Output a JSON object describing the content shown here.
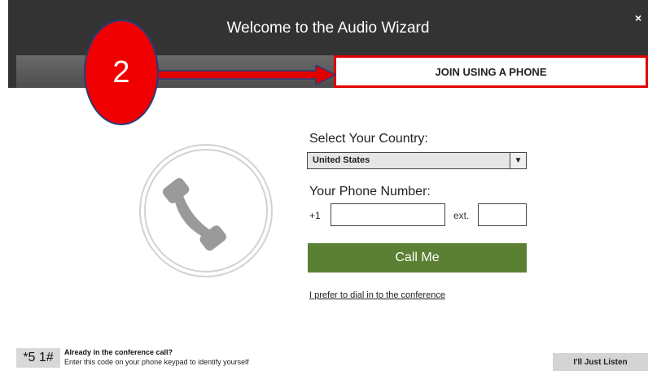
{
  "header": {
    "title": "Welcome to the Audio Wizard",
    "close_glyph": "×",
    "tab_phone_label": "JOIN USING A PHONE"
  },
  "annotation": {
    "step_number": "2",
    "circle_color": "#f00000",
    "arrow_color": "#e00000"
  },
  "form": {
    "country_label": "Select Your Country:",
    "country_value": "United States",
    "phone_label": "Your Phone Number:",
    "prefix": "+1",
    "phone_value": "",
    "ext_label": "ext.",
    "ext_value": "",
    "call_button": "Call Me",
    "dial_link": "I prefer to dial in to the conference"
  },
  "footer": {
    "code": "*5 1#",
    "already": "Already in the conference call?",
    "instructions": "Enter this code on your phone keypad to identify yourself",
    "listen_button": "I'll Just Listen"
  },
  "icons": {
    "phone": "phone-handset-icon",
    "close": "close-icon",
    "dropdown": "chevron-down-icon"
  },
  "colors": {
    "header_bg": "#333333",
    "call_button_bg": "#5b8033",
    "highlight_border": "#e00000"
  }
}
